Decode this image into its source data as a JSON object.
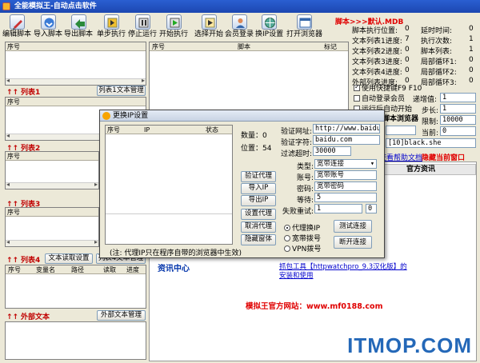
{
  "window": {
    "title": "全能模拟王-自动点击软件"
  },
  "toolbar": [
    {
      "label": "编辑脚本",
      "icon": "edit-icon"
    },
    {
      "label": "导入脚本",
      "icon": "import-icon"
    },
    {
      "label": "导出脚本",
      "icon": "export-icon"
    },
    {
      "label": "单步执行",
      "icon": "step-icon"
    },
    {
      "label": "停止运行",
      "icon": "stop-icon"
    },
    {
      "label": "开始执行",
      "icon": "play-icon"
    },
    {
      "label": "选择开始",
      "icon": "select-start-icon"
    },
    {
      "label": "会员登录",
      "icon": "member-icon"
    },
    {
      "label": "换IP设置",
      "icon": "ip-icon"
    },
    {
      "label": "打开浏览器",
      "icon": "browser-icon"
    }
  ],
  "left": {
    "list0_header": "序号",
    "list1": {
      "label": "列表1",
      "button": "列表1文本管理",
      "col": "序号"
    },
    "list2": {
      "label": "列表2",
      "col": "序号"
    },
    "list3": {
      "label": "列表3",
      "col": "序号"
    },
    "list4": {
      "label": "列表4",
      "button": "文本读取设置",
      "button2": "列表4文本管理",
      "cols": [
        "序号",
        "变量名",
        "路径",
        "读取",
        "进度"
      ]
    },
    "external": {
      "label": "外部文本",
      "button": "外部文本管理"
    },
    "arrows": "↑↑"
  },
  "script_table": {
    "cols": [
      "序号",
      "脚本",
      "标记"
    ]
  },
  "right": {
    "script_title": "脚本>>>默认.MDB",
    "stats": [
      {
        "k": "脚本执行位置:",
        "v": "0",
        "k2": "延时时间:",
        "v2": "0"
      },
      {
        "k": "文本列表1进度:",
        "v": "7",
        "k2": "执行次数:",
        "v2": "1"
      },
      {
        "k": "文本列表2进度:",
        "v": "0",
        "k2": "脚本列表:",
        "v2": "1"
      },
      {
        "k": "文本列表3进度:",
        "v": "0",
        "k2": "局部循环1:",
        "v2": "0"
      },
      {
        "k": "文本列表4进度:",
        "v": "0",
        "k2": "局部循环2:",
        "v2": "0"
      },
      {
        "k": "外部列表进度:",
        "v": "0",
        "k2": "局部循环3:",
        "v2": "0"
      }
    ],
    "hotkey": "使用快捷键F9 F10",
    "auto_login": "自动登录会员",
    "auto_start": "运行后自动开始",
    "browser_label": "脚本浏览器",
    "increment_label": "递增值:",
    "increment": "1",
    "step_label": "步长:",
    "step": "1",
    "limit_label": "限制:",
    "limit": "10000",
    "current_label": "当前:",
    "current": "0",
    "combo": "[10]black.she",
    "help_doc": "查看帮助文档",
    "hide_window": "隐藏当前窗口",
    "news_tab": "官方资讯"
  },
  "content": {
    "news_center": "资讯中心",
    "news_link_1": "抓包工具【httpwatchpro_9.3汉化版】的",
    "news_link_2": "安装和使用",
    "official_site": "模拟王官方网站：www.mf0188.com"
  },
  "dialog": {
    "title": "更换IP设置",
    "table_cols": [
      "序号",
      "IP",
      "状态"
    ],
    "count_label": "数量：",
    "count": "0",
    "position_label": "位置：",
    "position": "54",
    "verify_url_label": "验证网址:",
    "verify_url": "http://www.baidu.com",
    "verify_str_label": "验证字符:",
    "verify_str": "baidu.com",
    "timeout_label": "过滤超时:",
    "timeout": "30000",
    "type_label": "类型:",
    "type": "宽带连接",
    "account_label": "账号:",
    "account": "宽带账号",
    "password_label": "密码:",
    "password": "宽带密码",
    "wait_label": "等待:",
    "wait": "5",
    "fail_label": "失败重试:",
    "fail": "1",
    "fail2": "0",
    "buttons": [
      "验证代理",
      "导入IP",
      "导出IP",
      "设置代理",
      "取消代理",
      "隐藏窗体"
    ],
    "radio_proxy": "代理换IP",
    "radio_broadband": "宽带拨号",
    "radio_vpn": "VPN拨号",
    "test_button": "测试连接",
    "disconnect_button": "断开连接",
    "note": "(注: 代理IP只在程序自带的浏览器中生效)"
  },
  "watermark": "ITMOP.COM"
}
